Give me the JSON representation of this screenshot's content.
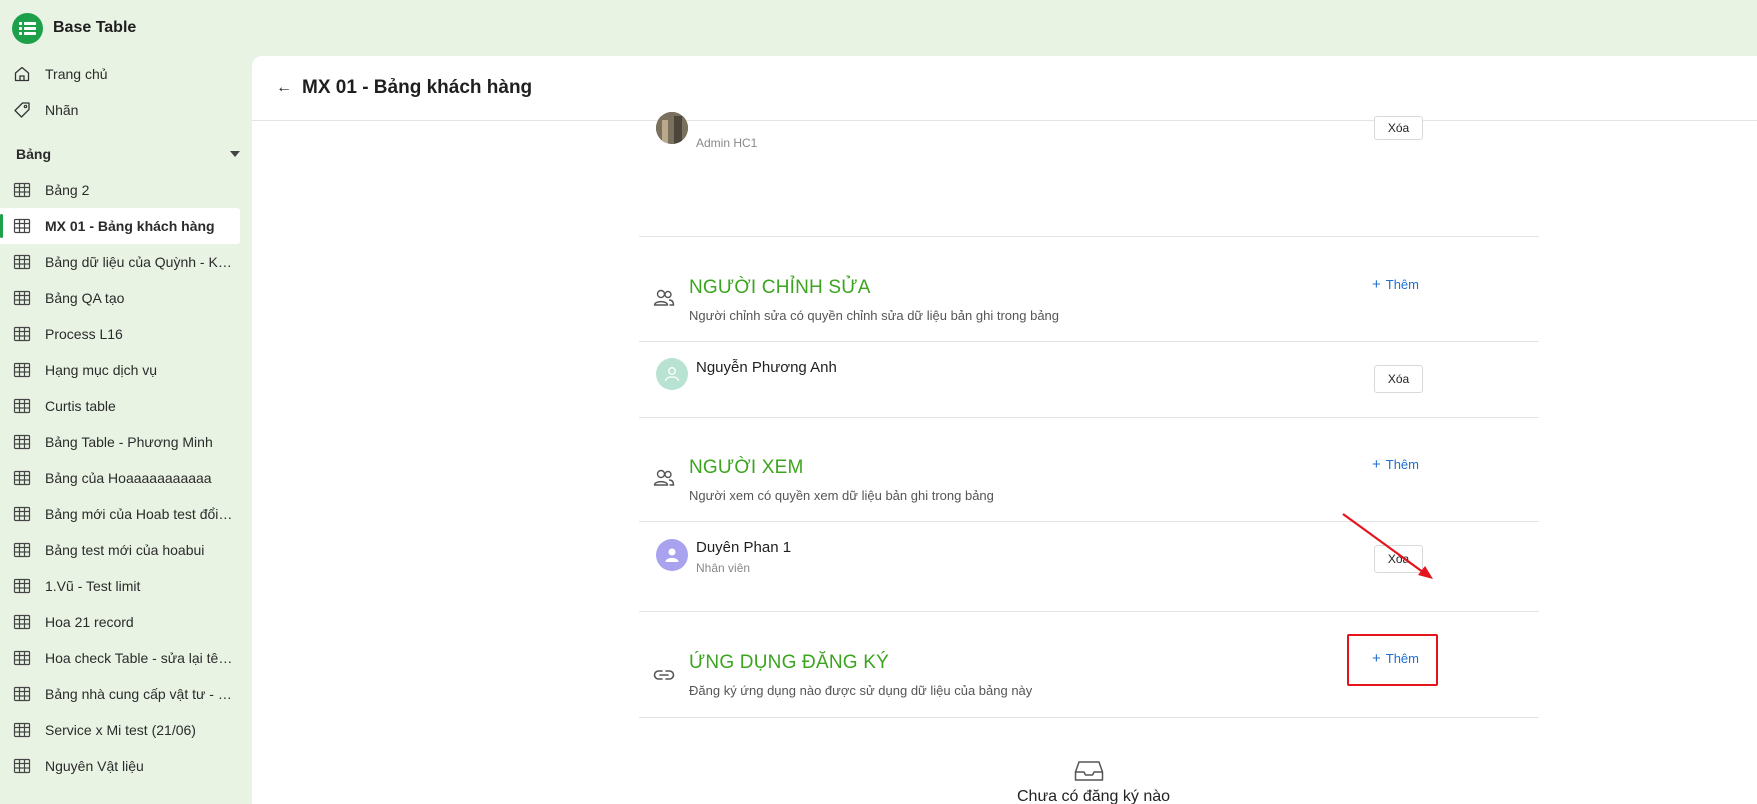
{
  "app": {
    "title": "Base Table"
  },
  "sidebar": {
    "nav": [
      {
        "label": "Trang chủ",
        "icon": "home-icon"
      },
      {
        "label": "Nhãn",
        "icon": "tag-icon"
      }
    ],
    "section_label": "Bảng",
    "tables": [
      {
        "label": "Bảng 2"
      },
      {
        "label": "MX 01 - Bảng khách hàng",
        "active": true
      },
      {
        "label": "Bảng dữ liệu của Quỳnh - KH..."
      },
      {
        "label": "Bảng QA tạo"
      },
      {
        "label": "Process L16"
      },
      {
        "label": "Hạng mục dịch vụ"
      },
      {
        "label": "Curtis table"
      },
      {
        "label": "Bảng Table - Phương Minh"
      },
      {
        "label": "Bảng của Hoaaaaaaaaaaa"
      },
      {
        "label": "Bảng mới của Hoab test đổi ..."
      },
      {
        "label": "Bảng test mới của hoabui"
      },
      {
        "label": "1.Vũ - Test limit"
      },
      {
        "label": "Hoa 21 record"
      },
      {
        "label": "Hoa check Table - sửa lại tên..."
      },
      {
        "label": "Bảng nhà cung cấp vật tư - CE"
      },
      {
        "label": "Service x Mi test (21/06)"
      },
      {
        "label": "Nguyên Vật liệu"
      }
    ]
  },
  "main": {
    "title": "MX 01 - Bảng khách hàng",
    "owner_row": {
      "role": "Admin HC1",
      "remove_label": "Xóa"
    },
    "editors": {
      "title": "NGƯỜI CHỈNH SỬA",
      "description": "Người chỉnh sửa có quyền chỉnh sửa dữ liệu bản ghi trong bảng",
      "add_label": "Thêm",
      "members": [
        {
          "name": "Nguyễn Phương Anh",
          "role": "",
          "remove_label": "Xóa"
        }
      ]
    },
    "viewers": {
      "title": "NGƯỜI XEM",
      "description": "Người xem có quyền xem dữ liệu bản ghi trong bảng",
      "add_label": "Thêm",
      "members": [
        {
          "name": "Duyên Phan 1",
          "role": "Nhân viên",
          "remove_label": "Xóa"
        }
      ]
    },
    "apps": {
      "title": "ỨNG DỤNG ĐĂNG KÝ",
      "description": "Đăng ký ứng dụng nào được sử dụng dữ liệu của bảng này",
      "add_label": "Thêm",
      "empty_text": "Chưa có đăng ký nào"
    }
  },
  "colors": {
    "accent_green": "#1ea04a",
    "section_title_green": "#3ba51f",
    "link_blue": "#1f6fd1",
    "annotation_red": "#e3141b"
  }
}
